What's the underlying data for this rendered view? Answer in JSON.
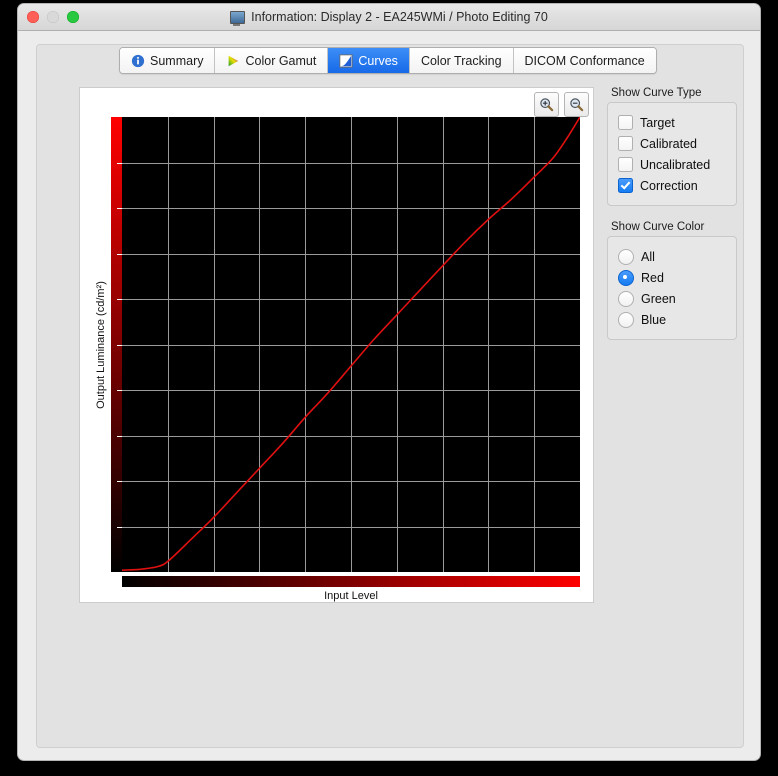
{
  "window": {
    "title": "Information: Display 2 - EA245WMi / Photo Editing 70",
    "title_icon": "monitor-icon",
    "controls": {
      "close": "close-button",
      "minimize": "minimize-button",
      "zoom": "zoom-button"
    }
  },
  "tabs": [
    {
      "label": "Summary",
      "icon": "info-circle-icon",
      "active": false
    },
    {
      "label": "Color Gamut",
      "icon": "gamut-triangle-icon",
      "active": false
    },
    {
      "label": "Curves",
      "icon": "curve-square-icon",
      "active": true
    },
    {
      "label": "Color Tracking",
      "icon": "",
      "active": false
    },
    {
      "label": "DICOM Conformance",
      "icon": "",
      "active": false
    }
  ],
  "chart_toolbar": {
    "zoom_in": "zoom-in-icon",
    "zoom_out": "zoom-out-icon"
  },
  "curve_type": {
    "group_label": "Show Curve Type",
    "options": [
      {
        "label": "Target",
        "checked": false
      },
      {
        "label": "Calibrated",
        "checked": false
      },
      {
        "label": "Uncalibrated",
        "checked": false
      },
      {
        "label": "Correction",
        "checked": true
      }
    ]
  },
  "curve_color": {
    "group_label": "Show Curve Color",
    "selected": "Red",
    "options": [
      {
        "label": "All",
        "selected": false
      },
      {
        "label": "Red",
        "selected": true
      },
      {
        "label": "Green",
        "selected": false
      },
      {
        "label": "Blue",
        "selected": false
      }
    ]
  },
  "chart_data": {
    "type": "line",
    "title": "",
    "xlabel": "Input Level",
    "ylabel": "Output Luminance (cd/m²)",
    "xlim": [
      0,
      255
    ],
    "ylim": [
      0,
      100
    ],
    "grid": true,
    "grid_columns": 10,
    "grid_rows": 10,
    "background": "#000000",
    "legend": "none",
    "x_axis_gradient": [
      "#000000",
      "#ff0000"
    ],
    "y_axis_gradient": [
      "#ff0000",
      "#000000"
    ],
    "series": [
      {
        "name": "Correction (Red)",
        "color": "#e01010",
        "x": [
          0,
          10,
          20,
          26,
          38,
          51,
          64,
          77,
          90,
          102,
          115,
          128,
          140,
          153,
          166,
          179,
          191,
          204,
          217,
          230,
          240,
          248,
          255
        ],
        "y": [
          0.4,
          0.6,
          1.2,
          2.5,
          7.0,
          12.0,
          17.5,
          23.0,
          28.5,
          34.0,
          39.5,
          45.5,
          51.0,
          56.5,
          62.0,
          67.5,
          72.5,
          77.5,
          82.0,
          87.0,
          91.0,
          95.5,
          100.0
        ]
      }
    ]
  }
}
